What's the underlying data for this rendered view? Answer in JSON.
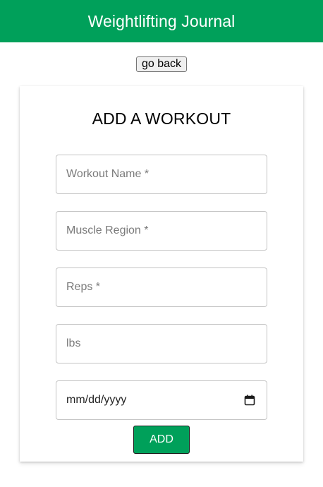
{
  "header": {
    "title": "Weightlifting Journal"
  },
  "nav": {
    "go_back_label": "go back"
  },
  "form": {
    "title": "ADD A WORKOUT",
    "fields": [
      {
        "placeholder": "Workout Name *"
      },
      {
        "placeholder": "Muscle Region *"
      },
      {
        "placeholder": "Reps *"
      },
      {
        "placeholder": "lbs"
      }
    ],
    "date_placeholder": "mm/dd/yyyy",
    "submit_label": "ADD"
  },
  "icons": {
    "date_picker": "calendar-icon"
  },
  "colors": {
    "brand": "#00a05a",
    "header_text": "#ffffff"
  }
}
